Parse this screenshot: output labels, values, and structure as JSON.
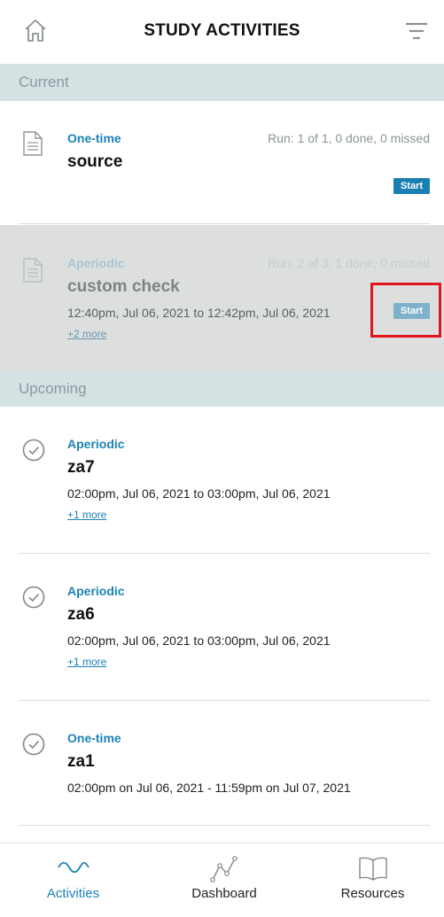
{
  "header": {
    "title": "STUDY ACTIVITIES"
  },
  "sections": {
    "current": "Current",
    "upcoming": "Upcoming"
  },
  "current": [
    {
      "type": "One-time",
      "run": "Run: 1 of 1, 0 done, 0 missed",
      "name": "source",
      "start": "Start"
    },
    {
      "type": "Aperiodic",
      "run": "Run: 2 of 3, 1 done, 0 missed",
      "name": "custom check",
      "time": "12:40pm, Jul 06, 2021 to 12:42pm, Jul 06, 2021",
      "more": "+2 more",
      "start": "Start"
    }
  ],
  "upcoming": [
    {
      "type": "Aperiodic",
      "name": "za7",
      "time": "02:00pm, Jul 06, 2021 to 03:00pm, Jul 06, 2021",
      "more": "+1 more"
    },
    {
      "type": "Aperiodic",
      "name": "za6",
      "time": "02:00pm, Jul 06, 2021 to 03:00pm, Jul 06, 2021",
      "more": "+1 more"
    },
    {
      "type": "One-time",
      "name": "za1",
      "time": "02:00pm on Jul 06, 2021 - 11:59pm on Jul 07, 2021"
    }
  ],
  "tabs": [
    {
      "label": "Activities",
      "icon": "wave-icon",
      "active": true
    },
    {
      "label": "Dashboard",
      "icon": "graph-icon",
      "active": false
    },
    {
      "label": "Resources",
      "icon": "book-icon",
      "active": false
    }
  ],
  "colors": {
    "accent": "#1a83b6",
    "band": "#d5e2e4",
    "highlight": "#e3141e"
  }
}
